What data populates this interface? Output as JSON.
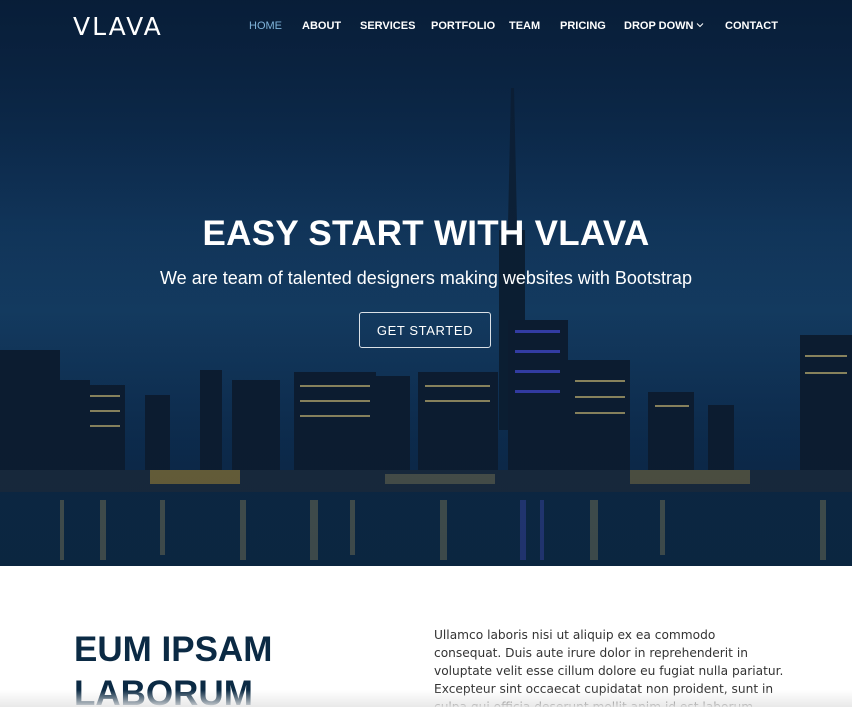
{
  "brand": {
    "logo_text": "VLAVA"
  },
  "nav": {
    "items": [
      {
        "label": "HOME",
        "active": true
      },
      {
        "label": "ABOUT",
        "active": false
      },
      {
        "label": "SERVICES",
        "active": false
      },
      {
        "label": "PORTFOLIO",
        "active": false
      },
      {
        "label": "TEAM",
        "active": false
      },
      {
        "label": "PRICING",
        "active": false
      },
      {
        "label": "DROP DOWN",
        "active": false,
        "icon": "chevron-down-icon"
      },
      {
        "label": "CONTACT",
        "active": false
      }
    ]
  },
  "hero": {
    "title": "EASY START WITH VLAVA",
    "subtitle": "We are team of talented designers making websites with Bootstrap",
    "cta_label": "GET STARTED",
    "background": "city-skyline-night-image"
  },
  "about": {
    "title": "EUM IPSAM LABORUM",
    "text": "Ullamco laboris nisi ut aliquip ex ea commodo consequat. Duis aute irure dolor in reprehenderit in voluptate velit esse cillum dolore eu fugiat nulla pariatur. Excepteur sint occaecat cupidatat non proident, sunt in culpa qui officia deserunt mollit anim id est laborum."
  },
  "colors": {
    "accent": "#7fb3d9",
    "heading": "#0b2a44",
    "hero_bg": "#10345a"
  }
}
